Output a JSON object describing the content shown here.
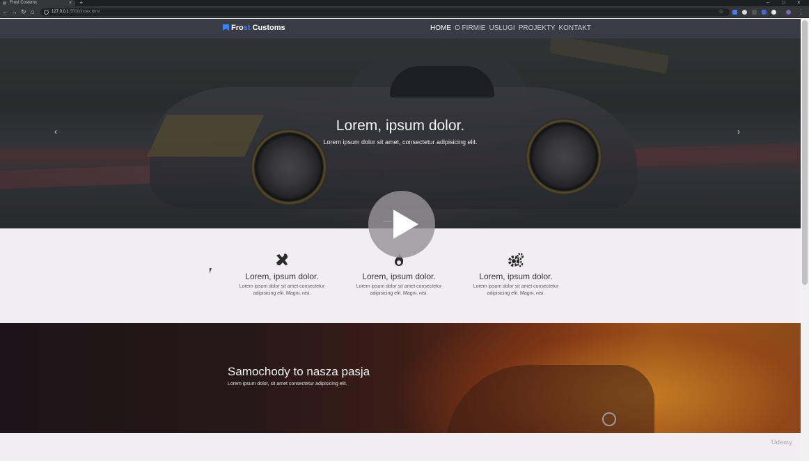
{
  "browser": {
    "tab_title": "Frost Customs",
    "tab_close": "×",
    "new_tab": "+",
    "url_host": "127.0.0.1",
    "url_path": ":5500/index.html",
    "window_controls": [
      "–",
      "□",
      "×"
    ]
  },
  "site": {
    "brand_prefix": "Fro",
    "brand_accent": "st",
    "brand_suffix": " Customs",
    "nav": [
      "HOME",
      "O FIRMIE",
      "USŁUGI",
      "PROJEKTY",
      "KONTAKT"
    ],
    "active_nav": "HOME",
    "accent_color": "#3b82f6"
  },
  "hero": {
    "title": "Lorem, ipsum dolor.",
    "subtitle": "Lorem ipsum dolor sit amet, consectetur adipisicing elit.",
    "prev_arrow": "‹",
    "next_arrow": "›",
    "slides": 3,
    "active_slide": 2
  },
  "features": [
    {
      "icon": "tools-icon",
      "title": "Lorem, ipsum dolor.",
      "text": "Lorem ipsum dolor sit amet consectetur adipisicing elit. Magni, nisi."
    },
    {
      "icon": "fire-icon",
      "title": "Lorem, ipsum dolor.",
      "text": "Lorem ipsum dolor sit amet consectetur adipisicing elit. Magni, nisi."
    },
    {
      "icon": "cogs-icon",
      "title": "Lorem, ipsum dolor.",
      "text": "Lorem ipsum dolor sit amet consectetur adipisicing elit. Magni, nisi."
    }
  ],
  "passion": {
    "title": "Samochody to nasza pasja",
    "subtitle": "Lorem ipsum dolor, sit amet consectetur adipisicing elit."
  },
  "watermark": "Udemy"
}
